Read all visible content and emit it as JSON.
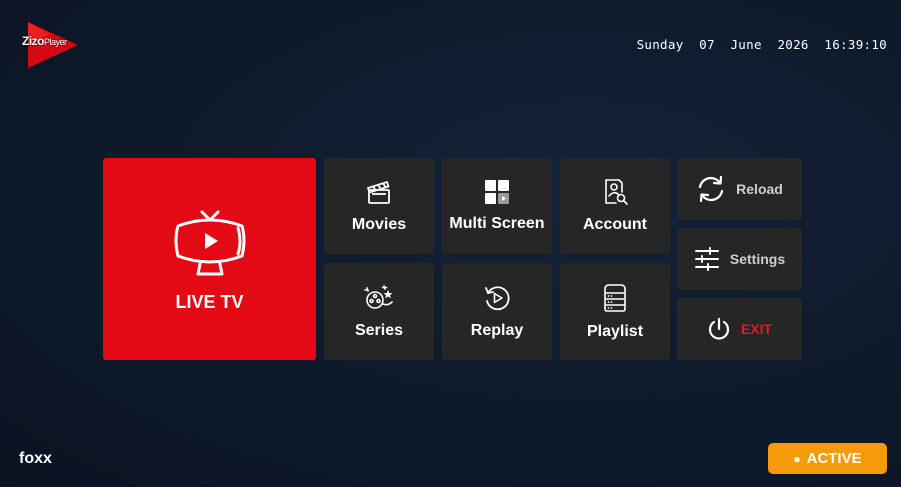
{
  "brand": {
    "name": "Zizo",
    "suffix": "Player"
  },
  "header": {
    "datetime": "Sunday  07  June  2026  16:39:10"
  },
  "menu": {
    "live_tv": "LIVE TV",
    "movies": "Movies",
    "multi_screen": "Multi Screen",
    "account": "Account",
    "series": "Series",
    "replay": "Replay",
    "playlist": "Playlist"
  },
  "side": {
    "reload": "Reload",
    "settings": "Settings",
    "exit": "EXIT"
  },
  "footer": {
    "username": "foxx",
    "status": "ACTIVE",
    "status_dot": "●"
  },
  "colors": {
    "accent": "#e30a15",
    "tile": "#262626",
    "status": "#f59b0a",
    "exit": "#e01b24"
  }
}
